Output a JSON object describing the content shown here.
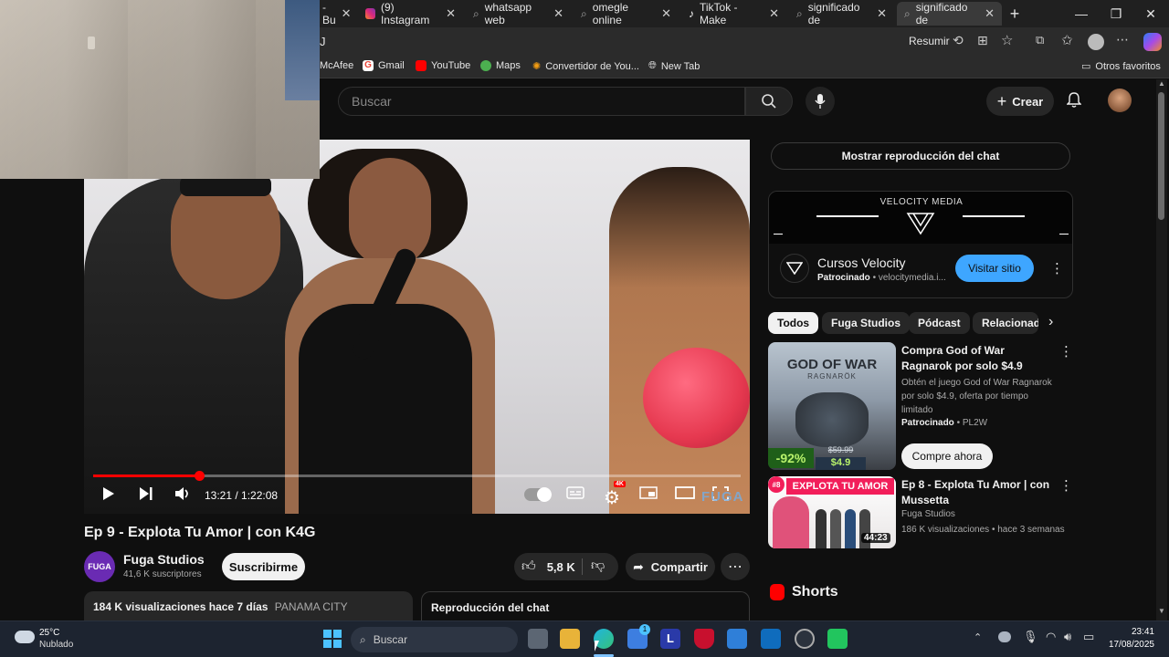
{
  "browser": {
    "tabs": [
      {
        "label": "- Bu"
      },
      {
        "label": "(9) Instagram"
      },
      {
        "label": "whatsapp web"
      },
      {
        "label": "omegle online"
      },
      {
        "label": "TikTok - Make"
      },
      {
        "label": "significado de"
      },
      {
        "label": "significado de"
      }
    ],
    "address": "J",
    "reader_label": "Resumir",
    "bookmarks": [
      "McAfee",
      "Gmail",
      "YouTube",
      "Maps",
      "Convertidor de You...",
      "New Tab"
    ],
    "other_favorites": "Otros favoritos"
  },
  "yt": {
    "search_placeholder": "Buscar",
    "create_label": "Crear"
  },
  "player": {
    "time": "13:21 / 1:22:08",
    "progress_fraction": 0.163,
    "watermark": "FUGA"
  },
  "video": {
    "title": "Ep 9 - Explota Tu Amor | con K4G",
    "channel": "Fuga Studios",
    "channel_avatar": "FUGA",
    "subscribers": "41,6 K suscriptores",
    "subscribe_label": "Suscribirme",
    "likes": "5,8 K",
    "share_label": "Compartir",
    "views_line": "184 K visualizaciones  hace 7 días",
    "location": "PANAMA CITY",
    "chat_replay_label": "Reproducción del chat"
  },
  "sidebar": {
    "show_chat_label": "Mostrar reproducción del chat",
    "ad": {
      "banner_title": "VELOCITY MEDIA",
      "name": "Cursos Velocity",
      "sponsored": "Patrocinado",
      "domain": "velocitymedia.i...",
      "cta": "Visitar sitio"
    },
    "chips": [
      "Todos",
      "Fuga Studios",
      "Pódcast",
      "Relacionad"
    ],
    "sponsored_item": {
      "title": "Compra God of War Ragnarok por solo $4.9",
      "description": "Obtén el juego God of War Ragnarok por solo $4.9, oferta por tiempo limitado",
      "sponsor": "Patrocinado",
      "advertiser": "PL2W",
      "cta": "Compre ahora",
      "thumb_title": "GOD OF WAR",
      "thumb_sub": "RAGNARÖK",
      "discount": "-92%",
      "old_price": "$59.99",
      "price": "$4.9"
    },
    "video_item": {
      "title": "Ep 8 - Explota Tu Amor | con Mussetta",
      "channel": "Fuga Studios",
      "meta": "186 K visualizaciones • hace 3 semanas",
      "duration": "44:23",
      "thumb_text": "EXPLOTA TU AMOR",
      "episode_badge": "#8"
    },
    "shorts_label": "Shorts"
  },
  "taskbar": {
    "weather_temp": "25°C",
    "weather_desc": "Nublado",
    "search_placeholder": "Buscar",
    "time": "23:41",
    "date": "17/08/2025",
    "store_badge": "1"
  }
}
